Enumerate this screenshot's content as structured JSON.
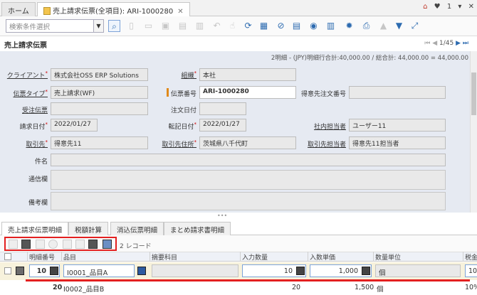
{
  "tabs": [
    {
      "label": "ホーム"
    },
    {
      "label": "売上請求伝票(全項目): ARI-1000280"
    }
  ],
  "top_right": {
    "alerts_count": "1"
  },
  "search": {
    "placeholder": "検索条件選択"
  },
  "window_title": "売上請求伝票",
  "pager": "1/45",
  "summary": "2明細 - (JPY)明細行合計:40,000.00 / 総合計: 44,000.00 = 44,000.00",
  "form": {
    "client_label": "クライアント",
    "client_value": "株式会社OSS ERP Solutions",
    "org_label": "組織",
    "org_value": "本社",
    "doctype_label": "伝票タイプ",
    "doctype_value": "売上請求(WF)",
    "docno_label": "伝票番号",
    "docno_value": "ARI-1000280",
    "cust_order_label": "得意先注文番号",
    "order_label": "受注伝票",
    "order_date_label": "注文日付",
    "invoice_date_label": "請求日付",
    "invoice_date_value": "2022/01/27",
    "acct_date_label": "転記日付",
    "acct_date_value": "2022/01/27",
    "sales_rep_label": "社内担当者",
    "sales_rep_value": "ユーザー11",
    "bpartner_label": "取引先",
    "bpartner_value": "得意先11",
    "bp_location_label": "取引先住所",
    "bp_location_value": "茨城県八千代町",
    "bp_contact_label": "取引先担当者",
    "bp_contact_value": "得意先11担当者",
    "subject_label": "件名",
    "comm_label": "通信欄",
    "remarks_label": "備考欄"
  },
  "detail_tabs": [
    {
      "label": "売上請求伝票明細"
    },
    {
      "label": "税額計算"
    },
    {
      "label": "消込伝票明細"
    },
    {
      "label": "まとめ請求書明細"
    }
  ],
  "record_count": "2 レコード",
  "grid": {
    "headers": [
      "明細番号",
      "品目",
      "摘要科目",
      "入力数量",
      "入数単価",
      "数量単位",
      "税金"
    ],
    "rows": [
      {
        "line": "10",
        "product": "I0001_品目A",
        "qty": "10",
        "price": "1,000",
        "uom": "個",
        "tax": "10"
      },
      {
        "line": "20",
        "product": "I0002_品目B",
        "qty": "20",
        "price": "1,500",
        "uom": "個",
        "tax": "10%"
      }
    ]
  },
  "colors": {
    "accent_red": "#e32020",
    "form_bg": "#e6eaf2",
    "orange_marker": "#e0891a"
  }
}
